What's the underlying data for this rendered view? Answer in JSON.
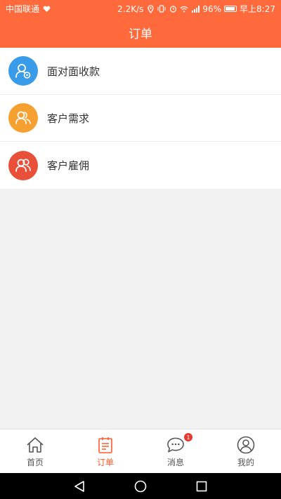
{
  "status_bar": {
    "carrier": "中国联通",
    "speed": "2.2K/s",
    "battery": "96%",
    "battery_level": 0.96,
    "time": "早上8:27"
  },
  "header": {
    "title": "订单"
  },
  "menu": {
    "items": [
      {
        "label": "面对面收款",
        "icon": "user-payment-icon",
        "color": "#3a9be8"
      },
      {
        "label": "客户需求",
        "icon": "customer-demand-icon",
        "color": "#f5a030"
      },
      {
        "label": "客户雇佣",
        "icon": "customer-hire-icon",
        "color": "#e8503a"
      }
    ]
  },
  "tabbar": {
    "tabs": [
      {
        "label": "首页",
        "icon": "home-icon"
      },
      {
        "label": "订单",
        "icon": "order-icon",
        "active": true
      },
      {
        "label": "消息",
        "icon": "message-icon",
        "badge": "1"
      },
      {
        "label": "我的",
        "icon": "profile-icon"
      }
    ]
  },
  "colors": {
    "brand": "#ff6a3c",
    "active_tab": "#ff5a2a",
    "badge": "#e8392f"
  }
}
